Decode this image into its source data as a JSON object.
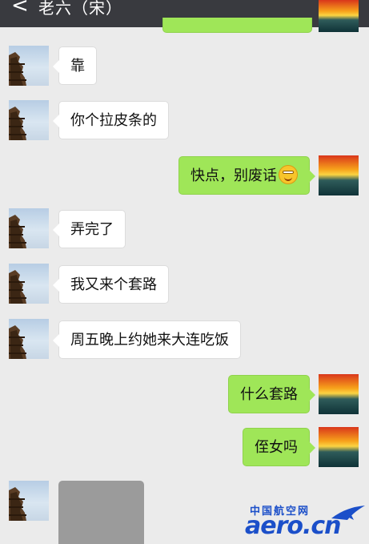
{
  "header": {
    "back_glyph": "<",
    "title": "老六（宋）",
    "more_glyph": "···"
  },
  "messages": [
    {
      "side": "left",
      "text": "靠"
    },
    {
      "side": "left",
      "text": "你个拉皮条的"
    },
    {
      "side": "right",
      "text": "快点，别废话",
      "emoji": "grinning-face-icon"
    },
    {
      "side": "left",
      "text": "弄完了"
    },
    {
      "side": "left",
      "text": "我又来个套路"
    },
    {
      "side": "left",
      "text": "周五晚上约她来大连吃饭"
    },
    {
      "side": "right",
      "text": "什么套路"
    },
    {
      "side": "right",
      "text": "侄女吗"
    },
    {
      "side": "left",
      "type": "image"
    }
  ],
  "watermark": {
    "cn": "中国航空网",
    "logo": "aero.cn"
  },
  "colors": {
    "topbar": "#393a3f",
    "background": "#ebebeb",
    "sent_bubble": "#9fe658",
    "received_bubble": "#ffffff",
    "watermark": "#1b4fc9"
  }
}
